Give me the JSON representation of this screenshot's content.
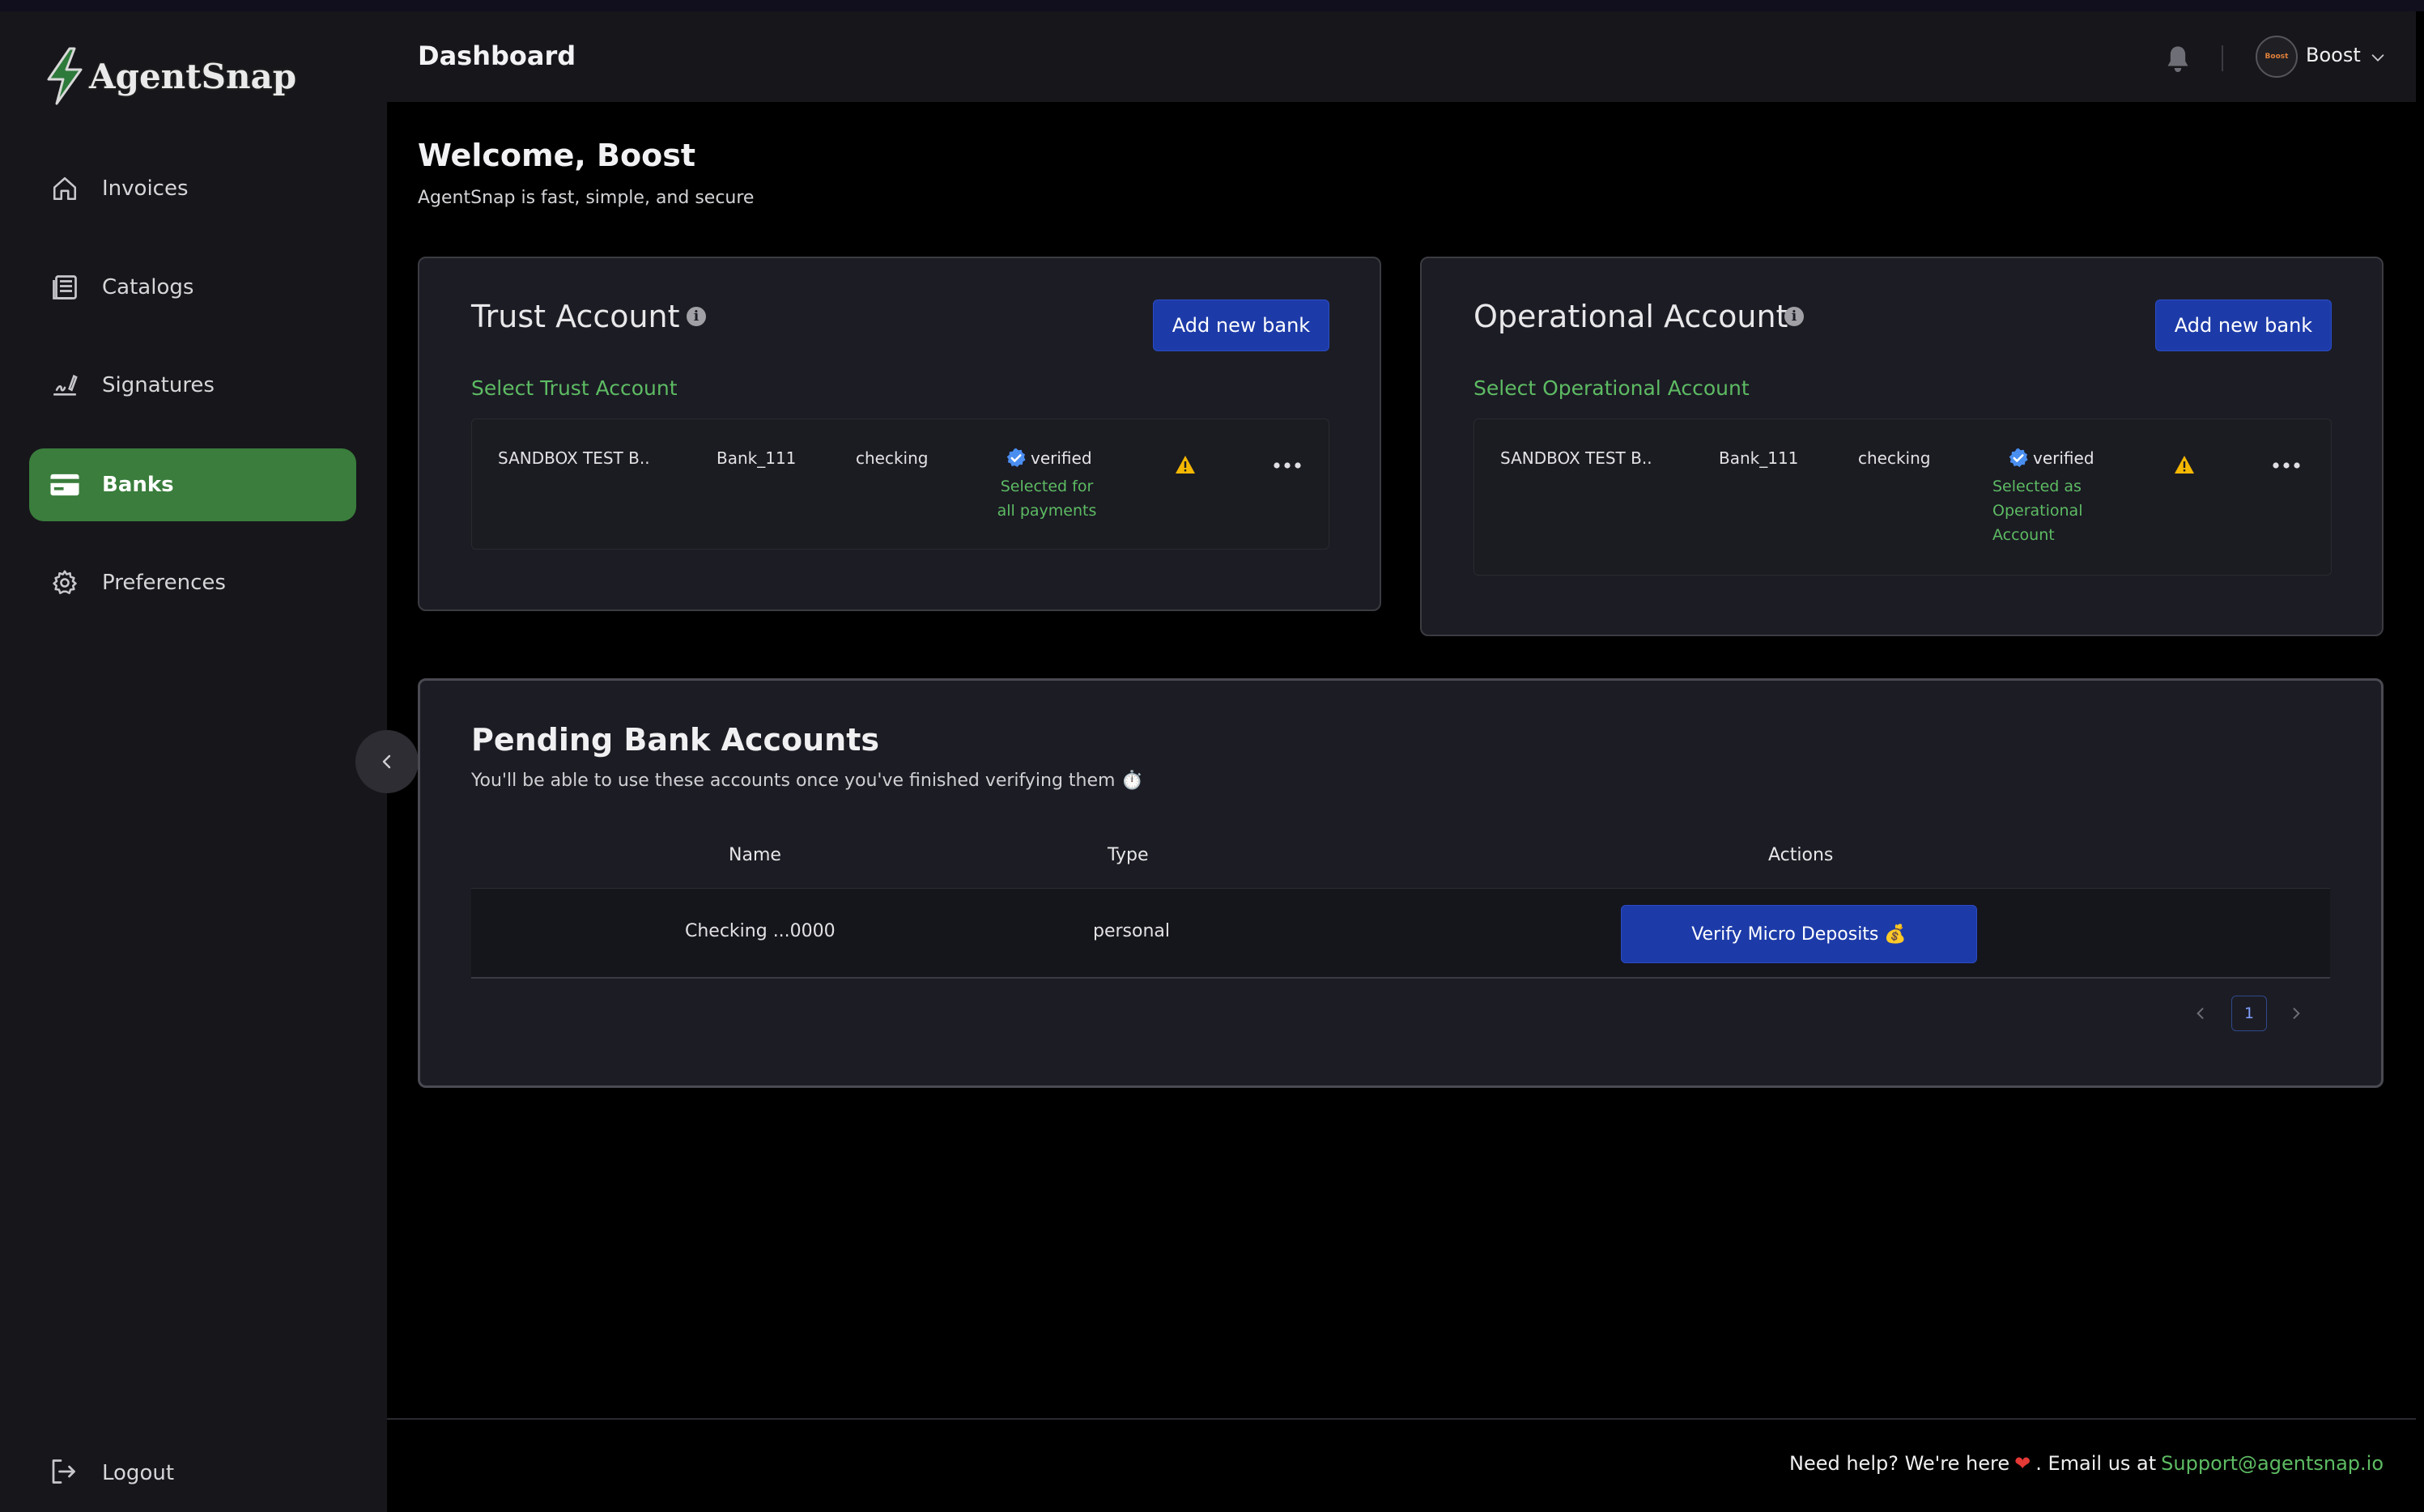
{
  "app": {
    "name": "AgentSnap"
  },
  "sidebar": {
    "items": [
      {
        "label": "Invoices",
        "icon": "home-icon"
      },
      {
        "label": "Catalogs",
        "icon": "catalog-icon"
      },
      {
        "label": "Signatures",
        "icon": "signature-icon"
      },
      {
        "label": "Banks",
        "icon": "bank-card-icon",
        "active": true
      },
      {
        "label": "Preferences",
        "icon": "gear-icon"
      }
    ],
    "logout": "Logout"
  },
  "header": {
    "title": "Dashboard",
    "user": {
      "name": "Boost",
      "avatar_text": "Boost"
    }
  },
  "welcome": {
    "title": "Welcome, Boost",
    "tagline": "AgentSnap is fast, simple, and secure"
  },
  "trust_account": {
    "title": "Trust Account",
    "add_button": "Add new bank",
    "select_label": "Select Trust Account",
    "bank": {
      "name": "SANDBOX TEST B..",
      "nickname": "Bank_111",
      "type": "checking",
      "status": "verified",
      "note_line1": "Selected for",
      "note_line2": "all payments"
    }
  },
  "operational_account": {
    "title": "Operational Account",
    "add_button": "Add new bank",
    "select_label": "Select Operational Account",
    "bank": {
      "name": "SANDBOX TEST B..",
      "nickname": "Bank_111",
      "type": "checking",
      "status": "verified",
      "note_line1": "Selected as",
      "note_line2": "Operational",
      "note_line3": "Account"
    }
  },
  "pending": {
    "title": "Pending Bank Accounts",
    "subtitle": "You'll be able to use these accounts once you've finished verifying them ⏱️",
    "columns": [
      "Name",
      "Type",
      "Actions"
    ],
    "rows": [
      {
        "name": "Checking ...0000",
        "type": "personal",
        "action": "Verify Micro Deposits 💰"
      }
    ],
    "pagination": {
      "current_page": "1"
    }
  },
  "footer": {
    "help_text": "Need help? We're here",
    "email_prefix": ". Email us at",
    "email": "Support@agentsnap.io"
  },
  "colors": {
    "accent_green": "#3a7d3c",
    "link_green": "#5dbb63",
    "primary_blue": "#1d3ba8",
    "warning": "#f5b800"
  }
}
